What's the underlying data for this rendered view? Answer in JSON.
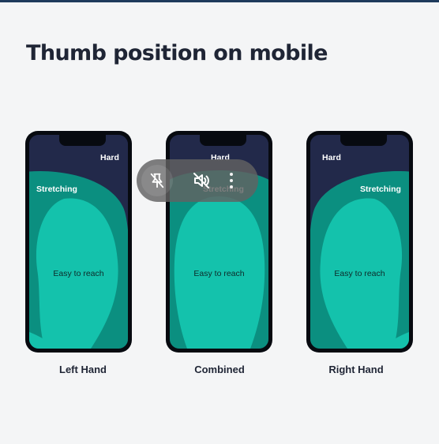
{
  "title": "Thumb position on mobile",
  "zones": {
    "hard": "Hard",
    "stretching": "Stretching",
    "easy": "Easy to reach"
  },
  "phones": [
    {
      "caption": "Left Hand"
    },
    {
      "caption": "Combined"
    },
    {
      "caption": "Right Hand"
    }
  ],
  "overlay": {
    "icons": [
      "pin-off-icon",
      "volume-mute-icon",
      "more-vertical-icon"
    ]
  },
  "colors": {
    "hard_zone": "#22294a",
    "stretch_zone": "#0b8f80",
    "easy_zone": "#14c2ac",
    "title": "#1f2535"
  }
}
